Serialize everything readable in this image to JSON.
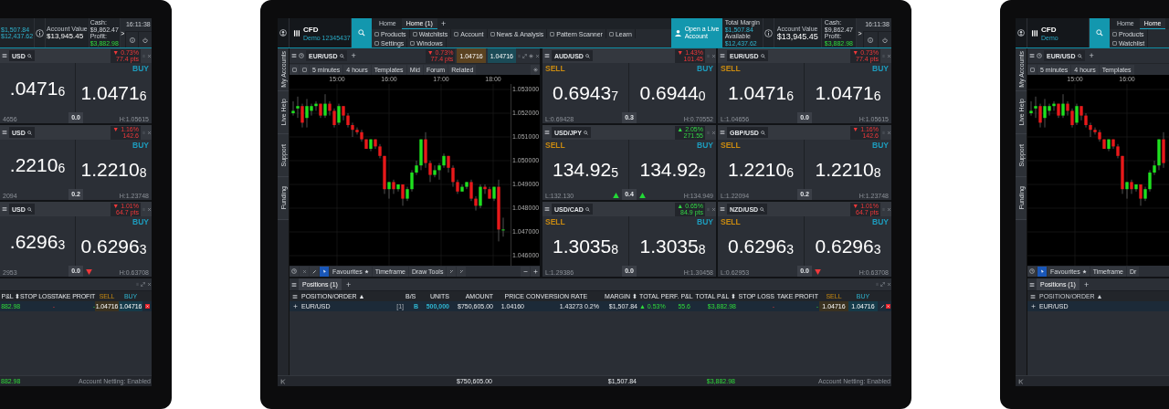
{
  "left_device": {
    "topbar": {
      "margin_values": [
        "$1,507.84",
        "$12,437.62"
      ],
      "account_value": {
        "label": "Account Value",
        "value": "$13,945.45"
      },
      "cash": {
        "label": "Cash:",
        "value": "$9,862.47"
      },
      "profit": {
        "label": "Profit:",
        "value": "$3,882.98"
      },
      "expand": ">",
      "time": "16:11:38"
    },
    "tiles": [
      {
        "pair": "USD",
        "change_pct": "▼ 0.73%",
        "change_pts": "77.4 pts",
        "rising": false,
        "buy_label": "BUY",
        "sell": [
          ".0471",
          "6"
        ],
        "buy": [
          "1.0471",
          "6"
        ],
        "low": "4656",
        "spread": "0.0",
        "high": "H:1.05615"
      },
      {
        "pair": "USD",
        "change_pct": "▼ 1.16%",
        "change_pts": "142.6",
        "rising": false,
        "buy_label": "BUY",
        "sell": [
          ".2210",
          "6"
        ],
        "buy": [
          "1.2210",
          "8"
        ],
        "low": "2094",
        "spread": "0.2",
        "high": "H:1.23748"
      },
      {
        "pair": "USD",
        "change_pct": "▼ 1.01%",
        "change_pts": "64.7 pts",
        "rising": false,
        "buy_label": "BUY",
        "sell": [
          ".6296",
          "3"
        ],
        "buy": [
          "0.6296",
          "3"
        ],
        "low": "2953",
        "spread": "0.0",
        "buy_arrow": true,
        "high": "H:0.63708"
      }
    ],
    "positions": {
      "columns": [
        {
          "label": "P&L ⬍",
          "kind": "text"
        },
        {
          "label": "STOP LOSS",
          "kind": "text"
        },
        {
          "label": "TAKE PROFIT",
          "kind": "text"
        },
        {
          "label": "SELL",
          "kind": "sell"
        },
        {
          "label": "BUY",
          "kind": "buy"
        }
      ],
      "row": [
        {
          "text": "882.98",
          "kind": "gain"
        },
        {
          "text": "-",
          "kind": "loss"
        },
        {
          "text": "-",
          "kind": "gain"
        },
        {
          "text": "1.04716",
          "kind": "sell-quote"
        },
        {
          "text": "1.04716",
          "kind": "buy-quote"
        }
      ]
    },
    "status": {
      "total": "882.98",
      "netting": "Account Netting: Enabled"
    }
  },
  "main_device": {
    "header": {
      "product": "CFD",
      "account": "Demo 12345437"
    },
    "tabs": [
      {
        "label": "Home",
        "selected": false
      },
      {
        "label": "Home (1)",
        "selected": true
      }
    ],
    "add_tab": "+",
    "menu": [
      "Products",
      "Watchlists",
      "Account",
      "News & Analysis",
      "Pattern Scanner",
      "Learn",
      "Settings",
      "Windows"
    ],
    "live_button": "Open a Live Account",
    "margin": [
      {
        "label": "Total Margin",
        "value": "$1,507.84"
      },
      {
        "label": "Available",
        "value": "$12,437.62"
      }
    ],
    "account_value": {
      "label": "Account Value",
      "value": "$13,945.45"
    },
    "cash": {
      "label": "Cash:",
      "value": "$9,862.47"
    },
    "profit": {
      "label": "Profit:",
      "value": "$3,882.98"
    },
    "expand": ">",
    "time": "16:11:38",
    "sidebar": [
      "My Accounts",
      "Live Help",
      "Support",
      "Funding"
    ],
    "chart_panel": {
      "pair": "EUR/USD",
      "add": "+",
      "change_pct": "▼ 0.73%",
      "change_pts": "77.4 pts",
      "rising": false,
      "sell": "1.04716",
      "buy": "1.04716",
      "toolbar": [
        "5 minutes",
        "4 hours",
        "Templates",
        "Mid",
        "Forum",
        "Related"
      ],
      "time_ticks": [
        "15:00",
        "16:00",
        "17:00",
        "18:00"
      ],
      "price_ticks": [
        "1.053000",
        "1.052000",
        "1.051000",
        "1.050000",
        "1.049000",
        "1.048000",
        "1.047000",
        "1.046000"
      ],
      "bottom_tools": [
        "Favourites",
        "Timeframe",
        "Draw Tools"
      ]
    },
    "tiles": [
      {
        "pair": "AUD/USD",
        "change_pct": "▼ 1.43%",
        "change_pts": "101.45",
        "rising": false,
        "sell_label": "SELL",
        "buy_label": "BUY",
        "sell": [
          "0.6943",
          "7"
        ],
        "buy": [
          "0.6944",
          "0"
        ],
        "low": "L:0.69428",
        "spread": "0.3",
        "high": "H:0.70552"
      },
      {
        "pair": "EUR/USD",
        "change_pct": "▼ 0.73%",
        "change_pts": "77.4 pts",
        "rising": false,
        "sell_label": "SELL",
        "buy_label": "BUY",
        "sell": [
          "1.0471",
          "6"
        ],
        "buy": [
          "1.0471",
          "6"
        ],
        "low": "L:1.04656",
        "spread": "0.0",
        "high": "H:1.05615"
      },
      {
        "pair": "USD/JPY",
        "change_pct": "▲ 2.05%",
        "change_pts": "271.55",
        "rising": true,
        "sell_label": "SELL",
        "buy_label": "BUY",
        "sell": [
          "134.92",
          "5"
        ],
        "buy": [
          "134.92",
          "9"
        ],
        "low": "L:132.130",
        "spread": "0.4",
        "sell_arrow": true,
        "buy_arrow": true,
        "high": "H:134.949"
      },
      {
        "pair": "GBP/USD",
        "change_pct": "▼ 1.16%",
        "change_pts": "142.6",
        "rising": false,
        "sell_label": "SELL",
        "buy_label": "BUY",
        "sell": [
          "1.2210",
          "6"
        ],
        "buy": [
          "1.2210",
          "8"
        ],
        "low": "L:1.22094",
        "spread": "0.2",
        "high": "H:1.23748"
      },
      {
        "pair": "USD/CAD",
        "change_pct": "▲ 0.65%",
        "change_pts": "84.9 pts",
        "rising": true,
        "sell_label": "SELL",
        "buy_label": "BUY",
        "sell": [
          "1.3035",
          "8"
        ],
        "buy": [
          "1.3035",
          "8"
        ],
        "low": "L:1.29386",
        "spread": "0.0",
        "high": "H:1.30458"
      },
      {
        "pair": "NZD/USD",
        "change_pct": "▼ 1.01%",
        "change_pts": "64.7 pts",
        "rising": false,
        "sell_label": "SELL",
        "buy_label": "BUY",
        "sell": [
          "0.6296",
          "3"
        ],
        "buy": [
          "0.6296",
          "3"
        ],
        "low": "L:0.62953",
        "spread": "0.0",
        "buy_arrow": true,
        "high": "H:0.63708"
      }
    ],
    "positions": {
      "title": "Positions (1)",
      "add": "+",
      "columns": [
        {
          "label": "POSITION/ORDER ▲",
          "kind": "text"
        },
        {
          "label": "B/S",
          "kind": "text"
        },
        {
          "label": "UNITS",
          "kind": "text"
        },
        {
          "label": "AMOUNT",
          "kind": "text"
        },
        {
          "label": "PRICE",
          "kind": "text"
        },
        {
          "label": "CONVERSION RATE",
          "kind": "text"
        },
        {
          "label": "MARGIN ⬍",
          "kind": "text"
        },
        {
          "label": "TOTAL PERF. P&L",
          "kind": "text"
        },
        {
          "label": "TOTAL P&L ⬍",
          "kind": "text"
        },
        {
          "label": "STOP LOSS",
          "kind": "text"
        },
        {
          "label": "TAKE PROFIT",
          "kind": "text"
        },
        {
          "label": "SELL",
          "kind": "sell"
        },
        {
          "label": "BUY",
          "kind": "buy"
        }
      ],
      "row": [
        {
          "text": "EUR/USD",
          "kind": "text"
        },
        {
          "text": "[1]",
          "kind": "count"
        },
        {
          "text": "B",
          "kind": "side"
        },
        {
          "text": "500,000",
          "kind": "side"
        },
        {
          "text": "$750,605.00",
          "kind": "text"
        },
        {
          "text": "1.04160",
          "kind": "text"
        },
        {
          "text": "1.43273",
          "kind": "text"
        },
        {
          "text": "0.2%",
          "kind": "text"
        },
        {
          "text": "$1,507.84",
          "kind": "text"
        },
        {
          "text": "▲ 0.53%",
          "kind": "gain"
        },
        {
          "text": "55.6",
          "kind": "gain"
        },
        {
          "text": "$3,882.98",
          "kind": "gain"
        },
        {
          "text": "-",
          "kind": "loss"
        },
        {
          "text": "-",
          "kind": "gain"
        },
        {
          "text": "1.04716",
          "kind": "sell-quote"
        },
        {
          "text": "1.04716",
          "kind": "buy-quote"
        }
      ],
      "totals": [
        {
          "text": "$750,605.00",
          "kind": "text"
        },
        {
          "text": "$1,507.84",
          "kind": "text"
        },
        {
          "text": "$3,882.98",
          "kind": "gain"
        }
      ],
      "netting": "Account Netting: Enabled"
    }
  },
  "right_device": {
    "header": {
      "product": "CFD",
      "account": "Demo"
    },
    "tabs": [
      {
        "label": "Home",
        "selected": false
      },
      {
        "label": "Home",
        "selected": true
      }
    ],
    "menu": [
      "Products",
      "Watchlist"
    ],
    "sidebar": [
      "My Accounts",
      "Live Help",
      "Support",
      "Funding"
    ],
    "chart_panel": {
      "pair": "EUR/USD",
      "add": "+",
      "toolbar": [
        "5 minutes",
        "4 hours",
        "Templates"
      ],
      "time_ticks": [
        "15:00",
        "16:00"
      ],
      "bottom_tools": [
        "Favourites",
        "Timeframe",
        "Dr"
      ]
    },
    "positions": {
      "title": "Positions (1)",
      "add": "+",
      "column": "POSITION/ORDER ▲",
      "row": "EUR/USD"
    }
  }
}
